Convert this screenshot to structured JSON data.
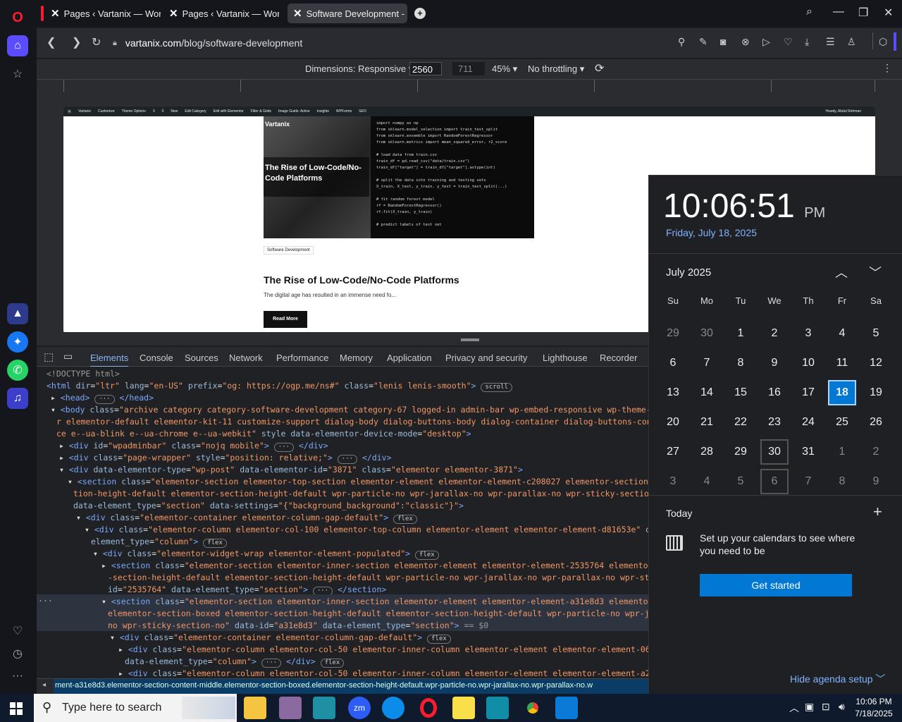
{
  "browser": {
    "tabs": [
      {
        "label": "Pages ‹ Vartanix — WordP",
        "active": false
      },
      {
        "label": "Pages ‹ Vartanix — WordP",
        "active": false
      },
      {
        "label": "Software Development - V",
        "active": true
      }
    ],
    "url_domain": "vartanix.com",
    "url_path": "/blog/software-development"
  },
  "devtools_toolbar": {
    "dimensions_label": "Dimensions: Responsive",
    "width": "2560",
    "height": "711",
    "zoom": "45%",
    "throttling": "No throttling"
  },
  "webpage": {
    "adminbar": [
      "Vartanix",
      "Customize",
      "Theme Options",
      "3",
      "0",
      "New",
      "Edit Category",
      "Edit with Elementor",
      "Filter & Grids",
      "Image Guide: Active",
      "Insights",
      "WPForms",
      "SEO"
    ],
    "adminbar_right": "Howdy, Abdul Rehman",
    "logo": "Vartanix",
    "hero_overlay": "The Rise of Low-Code/No-Code Platforms",
    "code_lines": [
      "import numpy as np",
      "from sklearn.model_selection import train_test_split",
      "from sklearn.ensemble import RandomForestRegressor",
      "from sklearn.metrics import mean_squared_error, r2_score",
      "",
      "# load data from train.csv",
      "train_df = pd.read_csv(\"data/train.csv\")",
      "train_df[\"target\"] = train_df[\"target\"].astype(int)",
      "",
      "# split the data into training and testing sets",
      "X_train, X_test, y_train, y_test = train_test_split(...)",
      "",
      "# fit random forest model",
      "rf = RandomForestRegressor()",
      "rf.fit(X_train, y_train)",
      "",
      "# predict labels of test set"
    ],
    "category": "Software Development",
    "title": "The Rise of Low-Code/No-Code Platforms",
    "excerpt": "The digital age has resulted in an immense need fo...",
    "read_more": "Read More"
  },
  "devtools_tabs": [
    "Elements",
    "Console",
    "Sources",
    "Network",
    "Performance",
    "Memory",
    "Application",
    "Privacy and security",
    "Lighthouse",
    "Recorder"
  ],
  "breadcrumb": "ment-a31e8d3.elementor-section-content-middle.elementor-section-boxed.elementor-section-height-default.wpr-particle-no.wpr-jarallax-no.wpr-parallax-no.w",
  "clock": {
    "time": "10:06:51",
    "ampm": "PM",
    "date": "Friday, July 18, 2025",
    "month": "July 2025",
    "weekdays": [
      "Su",
      "Mo",
      "Tu",
      "We",
      "Th",
      "Fr",
      "Sa"
    ],
    "days": [
      [
        "29",
        "30",
        "1",
        "2",
        "3",
        "4",
        "5"
      ],
      [
        "6",
        "7",
        "8",
        "9",
        "10",
        "11",
        "12"
      ],
      [
        "13",
        "14",
        "15",
        "16",
        "17",
        "18",
        "19"
      ],
      [
        "20",
        "21",
        "22",
        "23",
        "24",
        "25",
        "26"
      ],
      [
        "27",
        "28",
        "29",
        "30",
        "31",
        "1",
        "2"
      ],
      [
        "3",
        "4",
        "5",
        "6",
        "7",
        "8",
        "9"
      ]
    ],
    "today_label": "Today",
    "agenda_text": "Set up your calendars to see where you need to be",
    "get_started": "Get started",
    "hide_agenda": "Hide agenda setup"
  },
  "taskbar": {
    "search_placeholder": "Type here to search",
    "time": "10:06 PM",
    "date": "7/18/2025"
  },
  "colors": {
    "accent": "#0078d4",
    "browser_accent": "#5b4dff",
    "opera_red": "#ff1b2d"
  }
}
